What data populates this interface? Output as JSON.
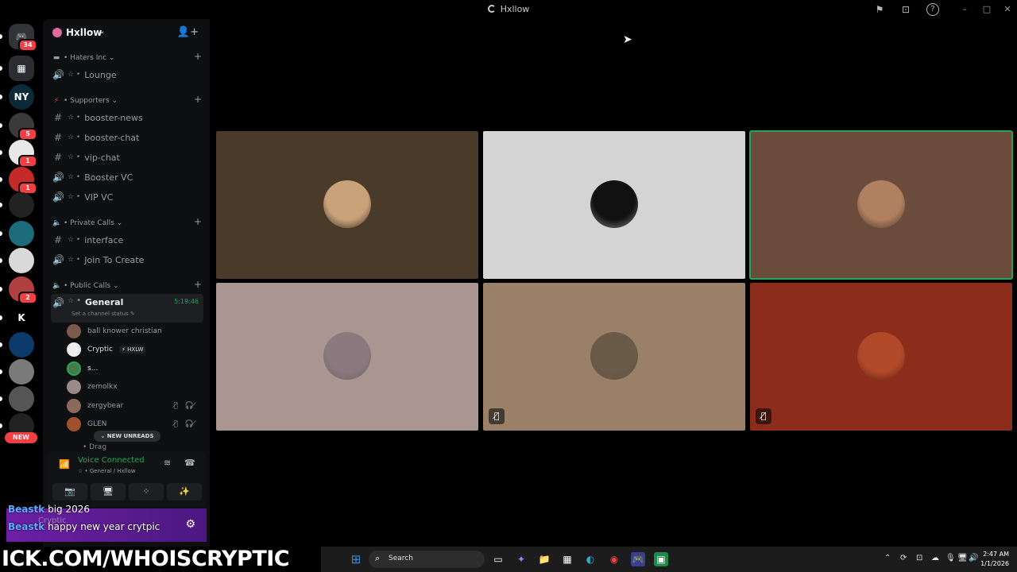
{
  "window": {
    "title": "Hxllow",
    "controls": {
      "minimize": "–",
      "maximize": "□",
      "close": "✕"
    },
    "actions": {
      "inbox": "⚑",
      "stop_stream": "⊡",
      "help": "?"
    }
  },
  "rail": {
    "servers": [
      {
        "name": "direct-messages",
        "glyph": "🎮",
        "badge": "34",
        "color": "#313338"
      },
      {
        "name": "server-1",
        "glyph": "▦",
        "badge": "",
        "color": "#2b2d31"
      },
      {
        "name": "server-ny",
        "glyph": "NY",
        "badge": "",
        "color": "#0a2a3a"
      },
      {
        "name": "server-3",
        "glyph": "",
        "badge": "5",
        "color": "#3a3a3a"
      },
      {
        "name": "server-4",
        "glyph": "",
        "badge": "1",
        "color": "#e8e8e8"
      },
      {
        "name": "server-5",
        "glyph": "",
        "badge": "1",
        "color": "#c42a2a"
      },
      {
        "name": "server-6",
        "glyph": "",
        "badge": "",
        "color": "#222"
      },
      {
        "name": "server-7",
        "glyph": "",
        "badge": "",
        "color": "#1b6b7a"
      },
      {
        "name": "server-8",
        "glyph": "",
        "badge": "",
        "color": "#d9d9d9"
      },
      {
        "name": "server-9",
        "glyph": "",
        "badge": "2",
        "color": "#b04040"
      },
      {
        "name": "server-kick",
        "glyph": "K",
        "badge": "",
        "color": "#000"
      },
      {
        "name": "server-11",
        "glyph": "",
        "badge": "",
        "color": "#0b3a6b"
      },
      {
        "name": "server-12",
        "glyph": "",
        "badge": "",
        "color": "#7a7a7a"
      },
      {
        "name": "server-13",
        "glyph": "",
        "badge": "",
        "color": "#555"
      },
      {
        "name": "server-14",
        "glyph": "",
        "badge": "",
        "color": "#222"
      }
    ],
    "new_label": "NEW"
  },
  "sidebar": {
    "server_name": "Hxllow",
    "server_chevron": "⌄",
    "invite_icon": "👤+",
    "categories": [
      {
        "label": "Haters Inc",
        "icon": "▬"
      },
      {
        "label": "Supporters",
        "icon": "⚡"
      },
      {
        "label": "Private Calls",
        "icon": "🔈"
      },
      {
        "label": "Public Calls",
        "icon": "🔈"
      }
    ],
    "channels": [
      {
        "label": "Lounge",
        "icon": "🔊"
      },
      {
        "label": "booster-news",
        "icon": "#"
      },
      {
        "label": "booster-chat",
        "icon": "#"
      },
      {
        "label": "vip-chat",
        "icon": "#"
      },
      {
        "label": "Booster VC",
        "icon": "🔊"
      },
      {
        "label": "VIP VC",
        "icon": "🔊"
      },
      {
        "label": "interface",
        "icon": "#"
      },
      {
        "label": "Join To Create",
        "icon": "🔊"
      }
    ],
    "active_channel": {
      "label": "General",
      "timer": "5:19:46",
      "status_placeholder": "Set a channel status ✎"
    },
    "voice_users": [
      {
        "name": "ball knower christian",
        "color": "#7a5a4a",
        "tag": ""
      },
      {
        "name": "Cryptic",
        "color": "#eee",
        "tag": "⚡ HXLW"
      },
      {
        "name": "s...",
        "color": "#4a7a4a",
        "tag": ""
      },
      {
        "name": "zemolkx",
        "color": "#9a8a8a",
        "tag": ""
      },
      {
        "name": "zergybear",
        "color": "#8a6a5a",
        "tag": ""
      },
      {
        "name": "GLEN",
        "color": "#a0522d",
        "tag": ""
      }
    ],
    "mute_icons": "🎙̸ 🎧̸",
    "new_unreads": "⌄ NEW UNREADS",
    "peek_channel": "• Drag"
  },
  "voice_panel": {
    "status": "Voice Connected",
    "channel": "☆ • General / Hxllow",
    "buttons": [
      "📷",
      "🖥",
      "⁘",
      "✨"
    ]
  },
  "chat_overlay": {
    "lines": [
      {
        "user": "Beastk",
        "text": "big 2026"
      },
      {
        "user": "Beastk",
        "text": "happy new year crytpic"
      }
    ],
    "ghost_label": "Cryptic"
  },
  "stage": {
    "tiles": [
      {
        "name": "tile-1",
        "bg": "#4a3a29",
        "avatar": "#c9a27a",
        "speaking": false,
        "icon": ""
      },
      {
        "name": "tile-2",
        "bg": "#d4d4d4",
        "avatar": "#111",
        "speaking": false,
        "icon": ""
      },
      {
        "name": "tile-3",
        "bg": "#6b4b3b",
        "avatar": "#b08060",
        "speaking": true,
        "icon": ""
      },
      {
        "name": "tile-4",
        "bg": "#aa9690",
        "avatar": "#8a7a80",
        "speaking": false,
        "icon": ""
      },
      {
        "name": "tile-5",
        "bg": "#9a8068",
        "avatar": "#6a5a48",
        "speaking": false,
        "icon": "🖥̸"
      },
      {
        "name": "tile-6",
        "bg": "#8b2d1a",
        "avatar": "#b24a2a",
        "speaking": false,
        "icon": "🖥̸"
      }
    ]
  },
  "taskbar": {
    "stream_url": "ICK.COM/WHOISCRYPTIC",
    "search_label": "Search",
    "apps": [
      "⊞",
      "▭",
      "✦",
      "📁",
      "▦",
      "◐",
      "◉",
      "🎮",
      "▣"
    ],
    "tray": [
      "⌃",
      "⟳",
      "⊡",
      "☁",
      "🎙",
      "🖥",
      "🔊"
    ],
    "time": "2:47 AM",
    "date": "1/1/2026"
  }
}
